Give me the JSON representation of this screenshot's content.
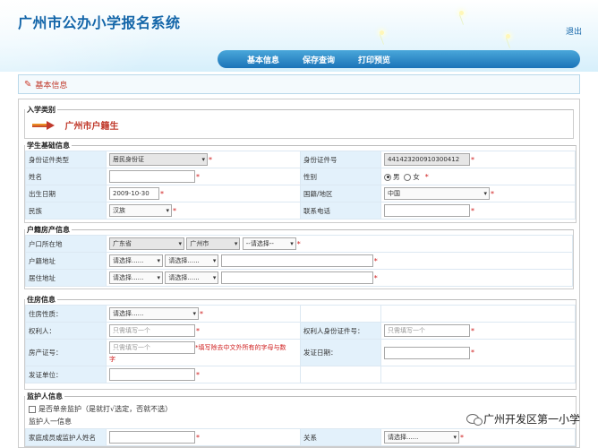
{
  "header": {
    "title": "广州市公办小学报名系统",
    "logout": "退出"
  },
  "nav": {
    "items": [
      "基本信息",
      "保存查询",
      "打印预览"
    ]
  },
  "section_title": "基本信息",
  "admission": {
    "legend": "入学类别",
    "value": "广州市户籍生"
  },
  "student": {
    "legend": "学生基础信息",
    "id_type_label": "身份证件类型",
    "id_type_value": "居民身份证",
    "id_no_label": "身份证件号",
    "id_no_value": "441423200910300412",
    "name_label": "姓名",
    "gender_label": "性别",
    "gender_male": "男",
    "gender_female": "女",
    "birth_label": "出生日期",
    "birth_value": "2009-10-30",
    "nation_label": "国籍/地区",
    "nation_value": "中国",
    "ethnic_label": "民族",
    "ethnic_value": "汉族",
    "phone_label": "联系电话"
  },
  "household": {
    "legend": "户籍房产信息",
    "hukou_label": "户口所在地",
    "province": "广东省",
    "city": "广州市",
    "district": "--请选择--",
    "hukou_addr_label": "户籍地址",
    "residence_label": "居住地址",
    "please_select": "请选择......"
  },
  "housing": {
    "legend": "住房信息",
    "nature_label": "住房性质：",
    "nature_value": "请选择......",
    "owner_label": "权利人：",
    "owner_placeholder": "只需填写一个",
    "owner_id_label": "权利人身份证件号：",
    "owner_id_placeholder": "只需填写一个",
    "deed_label": "房产证号：",
    "deed_placeholder": "只需填写一个",
    "deed_note_a": "*填写除去中文外所有的字母与数",
    "deed_note_b": "字",
    "issue_date_label": "发证日期：",
    "issuer_label": "发证单位："
  },
  "guardian": {
    "legend": "监护人信息",
    "single_parent": "是否单亲监护（是就打√选定，否就不选）",
    "guardian1": "监护人一信息",
    "member_name_label": "家庭成员或监护人姓名",
    "relation_label": "关系",
    "relation_value": "请选择......"
  },
  "watermark": "广州开发区第一小学"
}
